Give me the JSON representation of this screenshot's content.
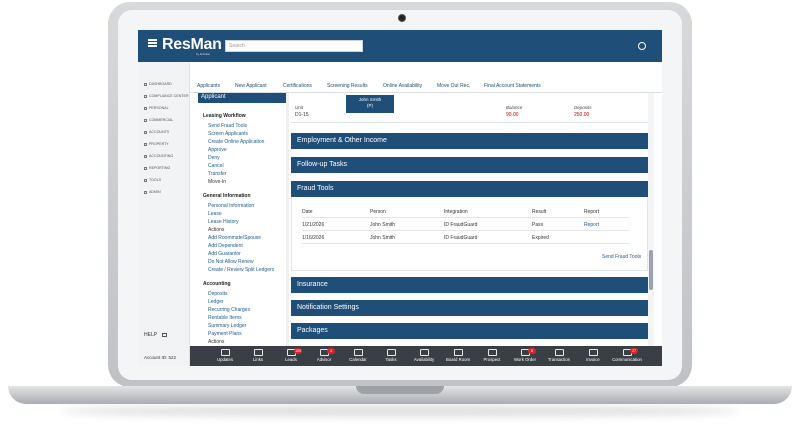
{
  "header": {
    "brand": "ResMan",
    "brand_sub": "by Entrata",
    "search_placeholder": "Search"
  },
  "left_nav": {
    "items": [
      "DASHBOARD",
      "COMPLIANCE CENTER",
      "PERSONAL",
      "COMMERCIAL",
      "ACCOUNTS",
      "PROPERTY",
      "ACCOUNTING",
      "REPORTING",
      "TOOLS",
      "ADMIN"
    ],
    "help": "HELP",
    "account_id": "Account ID: 522"
  },
  "tabs": [
    "Applicants",
    "New Applicant",
    "Certifications",
    "Screening Results",
    "Online Availability",
    "Move Out Rec.",
    "Final Account Statements"
  ],
  "applicant_panel": {
    "title": "Applicant",
    "leasing_workflow": {
      "title": "Leasing Workflow",
      "links": [
        "Send Fraud Tools",
        "Screen Applicants",
        "Create Online Application",
        "Approve",
        "Deny",
        "Cancel",
        "Transfer",
        "Move-In"
      ]
    },
    "general_information": {
      "title": "General Information",
      "links": [
        "Personal Information",
        "Lease",
        "Lease History",
        "Actions",
        "Add Roommate/Spouse",
        "Add Dependent",
        "Add Guarantor",
        "Do Not Allow Renew",
        "Create / Review Split Ledgers"
      ]
    },
    "accounting": {
      "title": "Accounting",
      "links": [
        "Deposits",
        "Ledger",
        "Recurring Charges",
        "Rentable Items",
        "Summary Ledger",
        "Payment Plans",
        "Actions"
      ]
    }
  },
  "unit": {
    "unit_label": "Unit",
    "unit_value": "D1-15",
    "name": "John Smith",
    "name_sub": "(P)",
    "balance_label": "Balance",
    "balance_value": "90.00",
    "deposits_label": "Deposits",
    "deposits_value": "250.00"
  },
  "sections": {
    "employment": "Employment & Other Income",
    "followup": "Follow-up Tasks",
    "fraud": "Fraud Tools",
    "insurance": "Insurance",
    "notification": "Notification Settings",
    "packages": "Packages"
  },
  "fraud_table": {
    "headers": [
      "Date",
      "Person",
      "Integration",
      "Result",
      "Report"
    ],
    "rows": [
      [
        "1/21/2026",
        "John Smith",
        "ID FraudGuard",
        "Pass",
        "Report"
      ],
      [
        "1/16/2026",
        "John Smith",
        "ID FraudGuard",
        "Expired",
        ""
      ]
    ],
    "send_link": "Send Fraud Tools"
  },
  "toolbar": [
    {
      "label": "Updates",
      "icon": "megaphone-icon",
      "badge": ""
    },
    {
      "label": "Links",
      "icon": "link-icon",
      "badge": ""
    },
    {
      "label": "Leads",
      "icon": "funnel-icon",
      "badge": "109"
    },
    {
      "label": "Advisor",
      "icon": "list-icon",
      "badge": "4"
    },
    {
      "label": "Calendar",
      "icon": "calendar-icon",
      "badge": ""
    },
    {
      "label": "Tasks",
      "icon": "checklist-icon",
      "badge": ""
    },
    {
      "label": "Availability",
      "icon": "bed-icon",
      "badge": ""
    },
    {
      "label": "Board Room",
      "icon": "chart-icon",
      "badge": ""
    },
    {
      "label": "Prospect",
      "icon": "person-icon",
      "badge": ""
    },
    {
      "label": "Work Order",
      "icon": "wrench-icon",
      "badge": "8"
    },
    {
      "label": "Transaction",
      "icon": "card-icon",
      "badge": ""
    },
    {
      "label": "Invoice",
      "icon": "invoice-icon",
      "badge": ""
    },
    {
      "label": "Communication",
      "icon": "chat-icon",
      "badge": "27"
    }
  ]
}
